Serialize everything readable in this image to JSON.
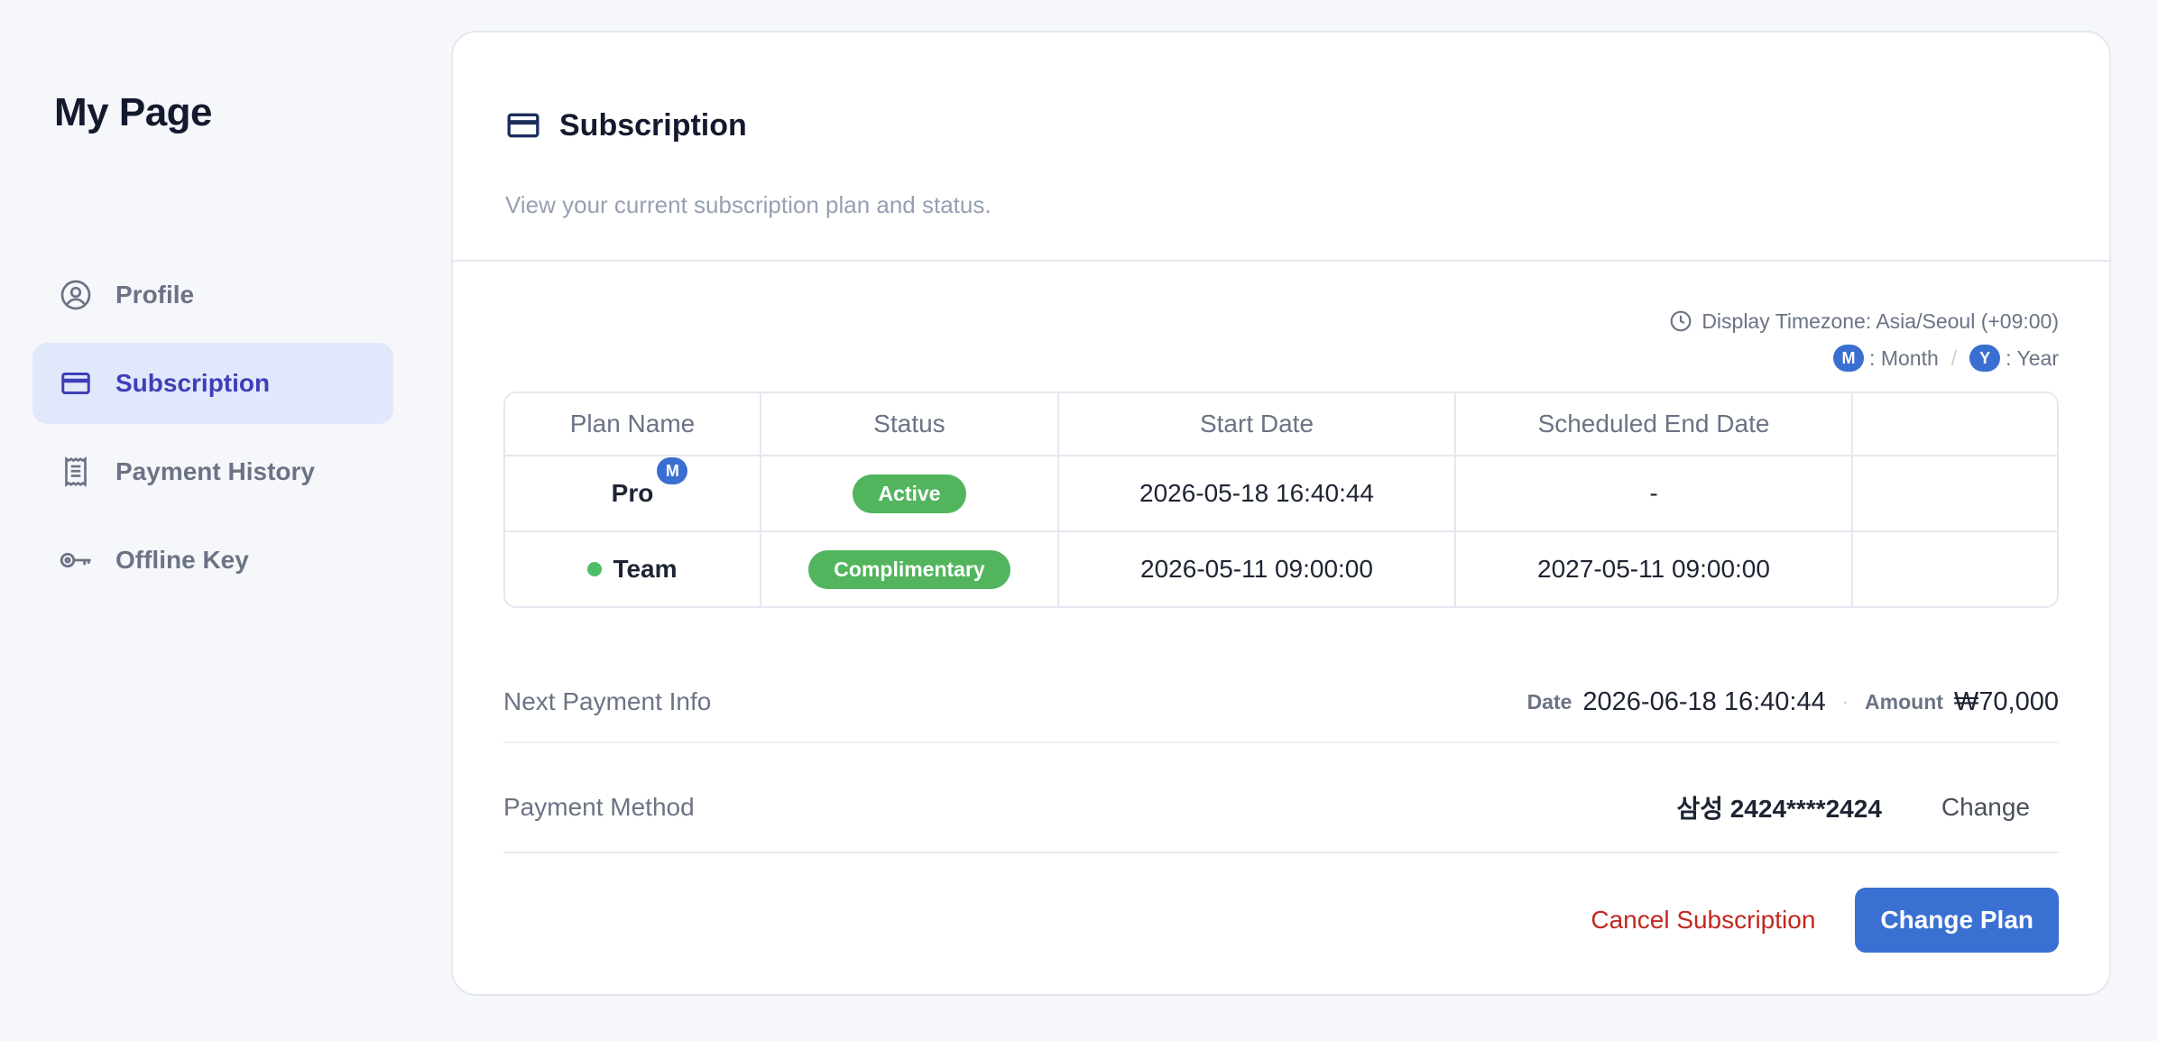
{
  "sidebar": {
    "title": "My Page",
    "items": [
      {
        "label": "Profile",
        "icon": "user-circle-icon"
      },
      {
        "label": "Subscription",
        "icon": "credit-card-icon",
        "active": true
      },
      {
        "label": "Payment History",
        "icon": "receipt-icon"
      },
      {
        "label": "Offline Key",
        "icon": "key-icon"
      }
    ]
  },
  "card": {
    "title": "Subscription",
    "subtitle": "View your current subscription plan and status.",
    "timezone": "Display Timezone: Asia/Seoul (+09:00)",
    "legend": {
      "month_badge": "M",
      "month_label": ": Month",
      "separator": "/",
      "year_badge": "Y",
      "year_label": ": Year"
    },
    "table": {
      "headers": [
        "Plan Name",
        "Status",
        "Start Date",
        "Scheduled End Date",
        ""
      ],
      "rows": [
        {
          "plan": "Pro",
          "badge": "M",
          "status": "Active",
          "start": "2026-05-18 16:40:44",
          "end": "-"
        },
        {
          "plan": "Team",
          "status": "Complimentary",
          "start": "2026-05-11 09:00:00",
          "end": "2027-05-11 09:00:00"
        }
      ]
    },
    "next_payment": {
      "label": "Next Payment Info",
      "date_label": "Date",
      "date": "2026-06-18 16:40:44",
      "separator": "·",
      "amount_label": "Amount",
      "amount": "₩70,000"
    },
    "payment_method": {
      "label": "Payment Method",
      "card": "삼성 2424****2424",
      "change_label": "Change"
    },
    "actions": {
      "cancel_label": "Cancel Subscription",
      "change_plan_label": "Change Plan"
    }
  },
  "colors": {
    "accent": "#3a70d2",
    "active_nav_bg": "#e2e8fb",
    "active_nav_text": "#3d3fb8",
    "status_green": "#52b55e",
    "danger": "#c0281f"
  }
}
